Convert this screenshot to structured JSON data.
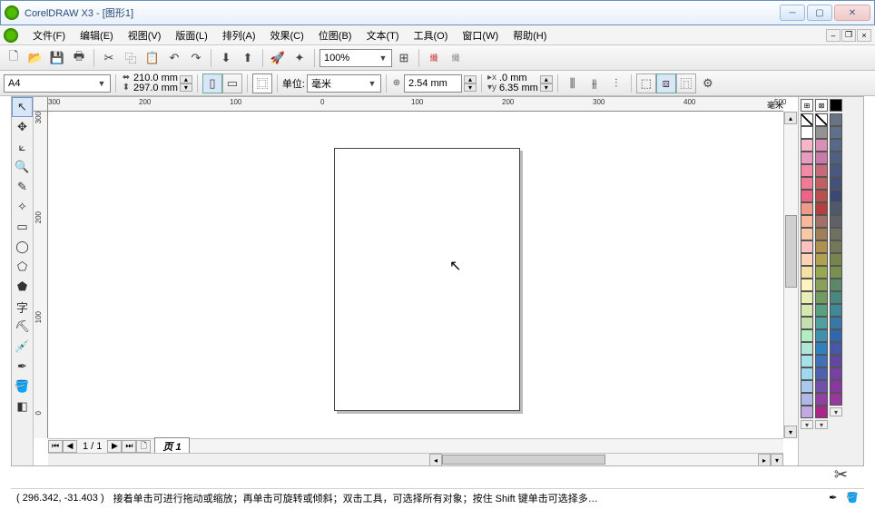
{
  "title": "CorelDRAW X3 - [图形1]",
  "menu": {
    "file": "文件(F)",
    "edit": "编辑(E)",
    "view": "视图(V)",
    "layout": "版面(L)",
    "arrange": "排列(A)",
    "effects": "效果(C)",
    "bitmap": "位图(B)",
    "text": "文本(T)",
    "tools": "工具(O)",
    "window": "窗口(W)",
    "help": "帮助(H)"
  },
  "toolbar": {
    "zoom": "100%"
  },
  "property": {
    "paper": "A4",
    "width": "210.0 mm",
    "height": "297.0 mm",
    "unit_label": "单位:",
    "unit_value": "毫米",
    "nudge": "2.54 mm",
    "dup_x": ".0 mm",
    "dup_y": "6.35 mm"
  },
  "ruler": {
    "unit_suffix": "毫米",
    "hticks": [
      "300",
      "200",
      "100",
      "0",
      "100",
      "200",
      "300",
      "400",
      "500"
    ],
    "vticks": [
      "300",
      "200",
      "100",
      "0"
    ]
  },
  "page": {
    "counter": "1 / 1",
    "tab": "页 1"
  },
  "status": {
    "coords": "( 296.342, -31.403 )",
    "hint": "接着单击可进行拖动或缩放；再单击可旋转或倾斜；双击工具，可选择所有对象；按住 Shift 键单击可选择多…"
  },
  "palette": {
    "left": [
      "#ffffff",
      "#f6b7c8",
      "#e89cc0",
      "#f48aa8",
      "#f27a95",
      "#ee6488",
      "#ee9b8c",
      "#f7b89b",
      "#f7c9a5",
      "#ffc1c1",
      "#ffd3b3",
      "#f4e1a6",
      "#fff4c0",
      "#e6f0b4",
      "#d6e8b0",
      "#c4e0b0",
      "#b0f0c0",
      "#b0e6d6",
      "#a8e0e8",
      "#a0d8f0",
      "#a8c8f0",
      "#b0b8e8",
      "#c0a8e0"
    ],
    "middle": [
      "#939393",
      "#d890b4",
      "#c87aa8",
      "#c46a78",
      "#c06060",
      "#b85050",
      "#b24040",
      "#a27068",
      "#a08058",
      "#b09050",
      "#b0a050",
      "#98a850",
      "#88a058",
      "#709c60",
      "#58a080",
      "#50a0a0",
      "#4090b0",
      "#3080c0",
      "#4070b8",
      "#5060b0",
      "#7050a8",
      "#9040a0",
      "#a82888"
    ],
    "right": [
      "#697386",
      "#60708c",
      "#586888",
      "#506084",
      "#485880",
      "#42507a",
      "#3c4874",
      "#50586c",
      "#606068",
      "#707060",
      "#747858",
      "#788450",
      "#7a9050",
      "#5a8868",
      "#488880",
      "#408898",
      "#3878a8",
      "#3068b0",
      "#4858a8",
      "#6048a0",
      "#7840a0",
      "#8838a0",
      "#98389c"
    ]
  }
}
